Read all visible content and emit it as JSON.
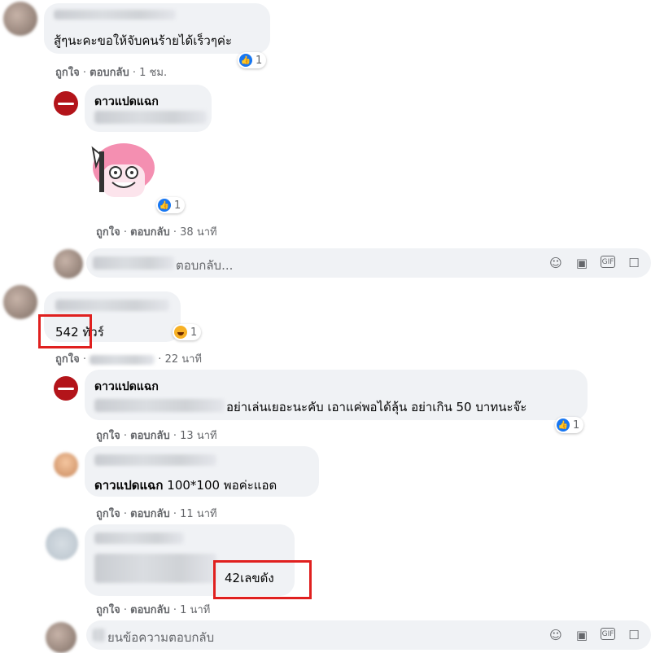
{
  "comments": [
    {
      "text": "สู้ๆนะคะขอให้จับคนร้ายได้เร็วๆค่ะ",
      "meta_like": "ถูกใจ",
      "meta_reply": "ตอบกลับ",
      "meta_time": "1 ชม.",
      "reaction_count": "1"
    },
    {
      "name": "ดาวแปดแฉก",
      "meta_like": "ถูกใจ",
      "meta_reply": "ตอบกลับ",
      "meta_time": "38 นาที",
      "reaction_count": "1"
    },
    {
      "text_partial": "ตอบกลับ..."
    },
    {
      "text": "542 ทัวร์",
      "highlight": "542",
      "meta_like": "ถูกใจ",
      "meta_time": "22 นาที",
      "reaction_count": "1"
    },
    {
      "name": "ดาวแปดแฉก",
      "text": "อย่าเล่นเยอะนะคับ เอาแค่พอได้ลุ้น อย่าเกิน 50 บาทนะจ๊ะ",
      "meta_like": "ถูกใจ",
      "meta_reply": "ตอบกลับ",
      "meta_time": "13 นาที",
      "reaction_count": "1"
    },
    {
      "mention": "ดาวแปดแฉก",
      "text": "100*100 พอค่ะแอด",
      "meta_like": "ถูกใจ",
      "meta_reply": "ตอบกลับ",
      "meta_time": "11 นาที"
    },
    {
      "text": "42เลขดัง",
      "meta_like": "ถูกใจ",
      "meta_reply": "ตอบกลับ",
      "meta_time": "1 นาที"
    },
    {
      "text_partial": "ยนข้อความตอบกลับ"
    }
  ],
  "separator": "·",
  "icons": [
    "like-icon",
    "haha-icon",
    "emoji-icon",
    "camera-icon",
    "gif-icon",
    "sticker-icon"
  ]
}
